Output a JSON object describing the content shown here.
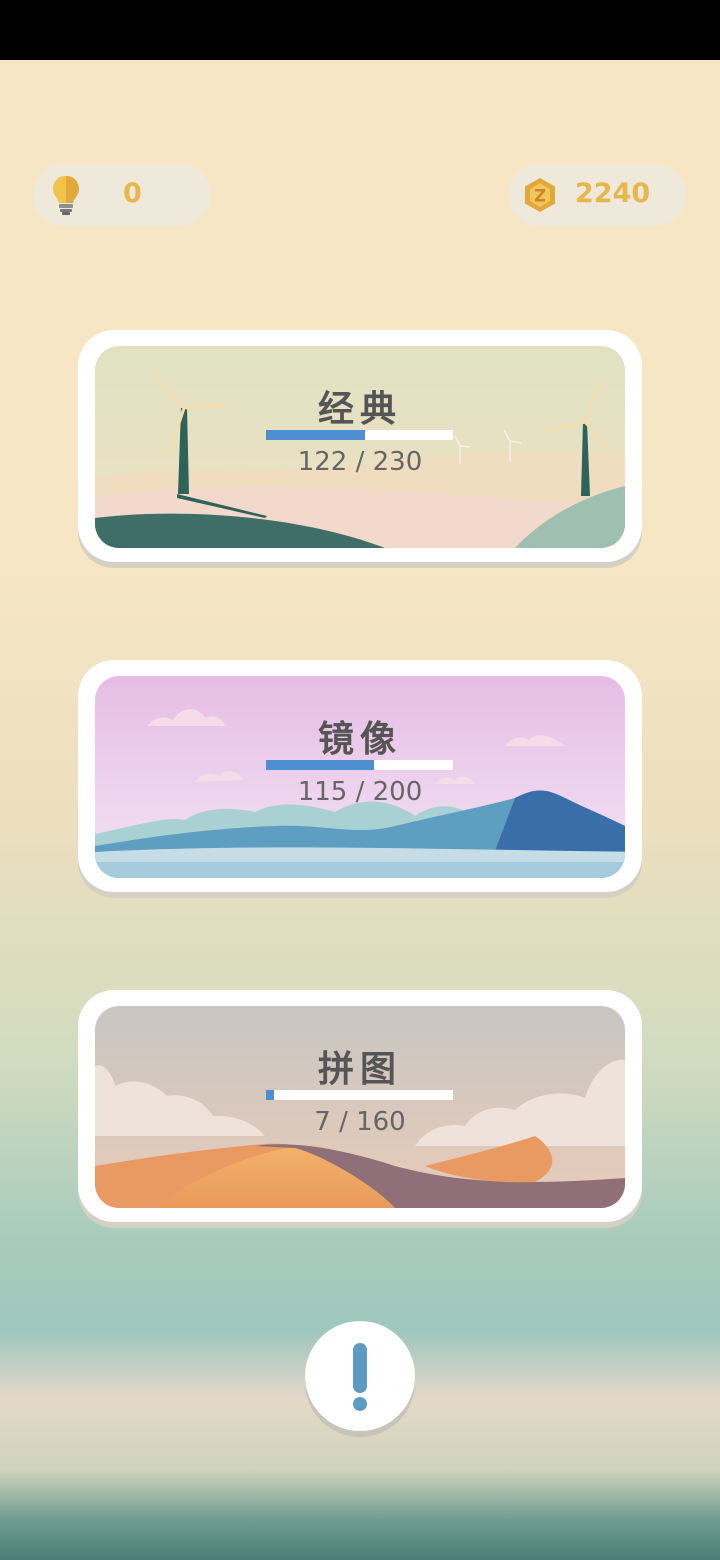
{
  "hints": {
    "icon": "lightbulb-icon",
    "count": "0"
  },
  "coins": {
    "icon": "coin-icon",
    "count": "2240"
  },
  "modes": [
    {
      "title": "经典",
      "progress_text": "122 / 230",
      "progress": 0.53
    },
    {
      "title": "镜像",
      "progress_text": "115 / 200",
      "progress": 0.575
    },
    {
      "title": "拼图",
      "progress_text": "7 / 160",
      "progress": 0.044
    }
  ],
  "info_button": {
    "icon": "exclamation-icon"
  },
  "colors": {
    "accent": "#e7b64c",
    "progress": "#4d8fd0",
    "title": "#555555"
  }
}
